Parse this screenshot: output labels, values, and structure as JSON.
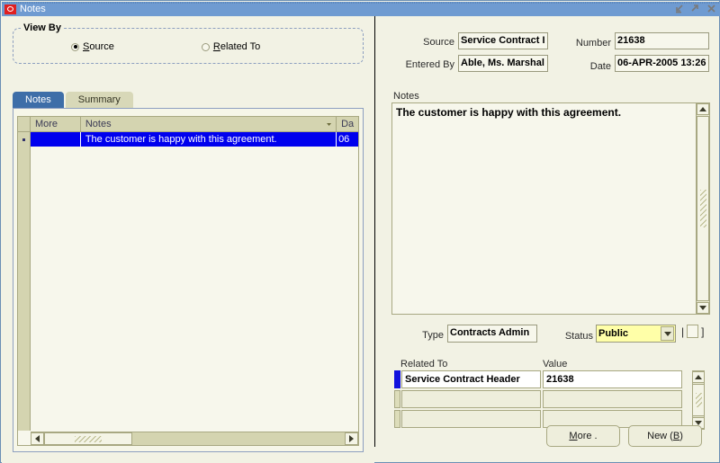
{
  "window": {
    "title": "Notes",
    "logo_icon": "oracle-logo",
    "controls": [
      {
        "name": "minimize-button",
        "icon": "minimize-icon"
      },
      {
        "name": "maximize-button",
        "icon": "maximize-icon"
      },
      {
        "name": "close-button",
        "icon": "close-icon"
      }
    ]
  },
  "view_by": {
    "legend": "View By",
    "options": [
      {
        "label": "Source",
        "mnemonic": "S",
        "selected": true
      },
      {
        "label": "Related To",
        "mnemonic": "R",
        "selected": false
      }
    ]
  },
  "tabs": [
    {
      "label": "Notes",
      "active": true
    },
    {
      "label": "Summary",
      "active": false
    }
  ],
  "grid": {
    "columns": [
      "More",
      "Notes",
      "Da"
    ],
    "rows": [
      {
        "indicator": "•",
        "more": "",
        "notes": "The customer is happy with this agreement.",
        "date": "06"
      }
    ],
    "scroll_left_icon": "scroll-left-icon",
    "scroll_right_icon": "scroll-right-icon"
  },
  "detail": {
    "source_label": "Source",
    "source_value": "Service Contract I",
    "entered_by_label": "Entered By",
    "entered_by_value": "Able, Ms. Marshal",
    "number_label": "Number",
    "number_value": "21638",
    "date_label": "Date",
    "date_value": "06-APR-2005 13:26",
    "notes_label": "Notes",
    "notes_value": "The customer is happy with this agreement.",
    "type_label": "Type",
    "type_value": "Contracts Admin",
    "status_label": "Status",
    "status_value": "Public",
    "status_bg": "#ffffa8",
    "checkbox_open": "|",
    "checkbox_close": "]",
    "checkbox_checked": false
  },
  "related_to": {
    "col_related_to": "Related To",
    "col_value": "Value",
    "rows": [
      {
        "related_to": "Service Contract Header",
        "value": "21638",
        "current": true
      },
      {
        "related_to": "",
        "value": "",
        "current": false
      },
      {
        "related_to": "",
        "value": "",
        "current": false
      }
    ]
  },
  "buttons": {
    "more": {
      "pre": "",
      "mnemonic": "M",
      "post": "ore ."
    },
    "new": {
      "pre": "New (",
      "mnemonic": "B",
      "post": ")"
    }
  }
}
